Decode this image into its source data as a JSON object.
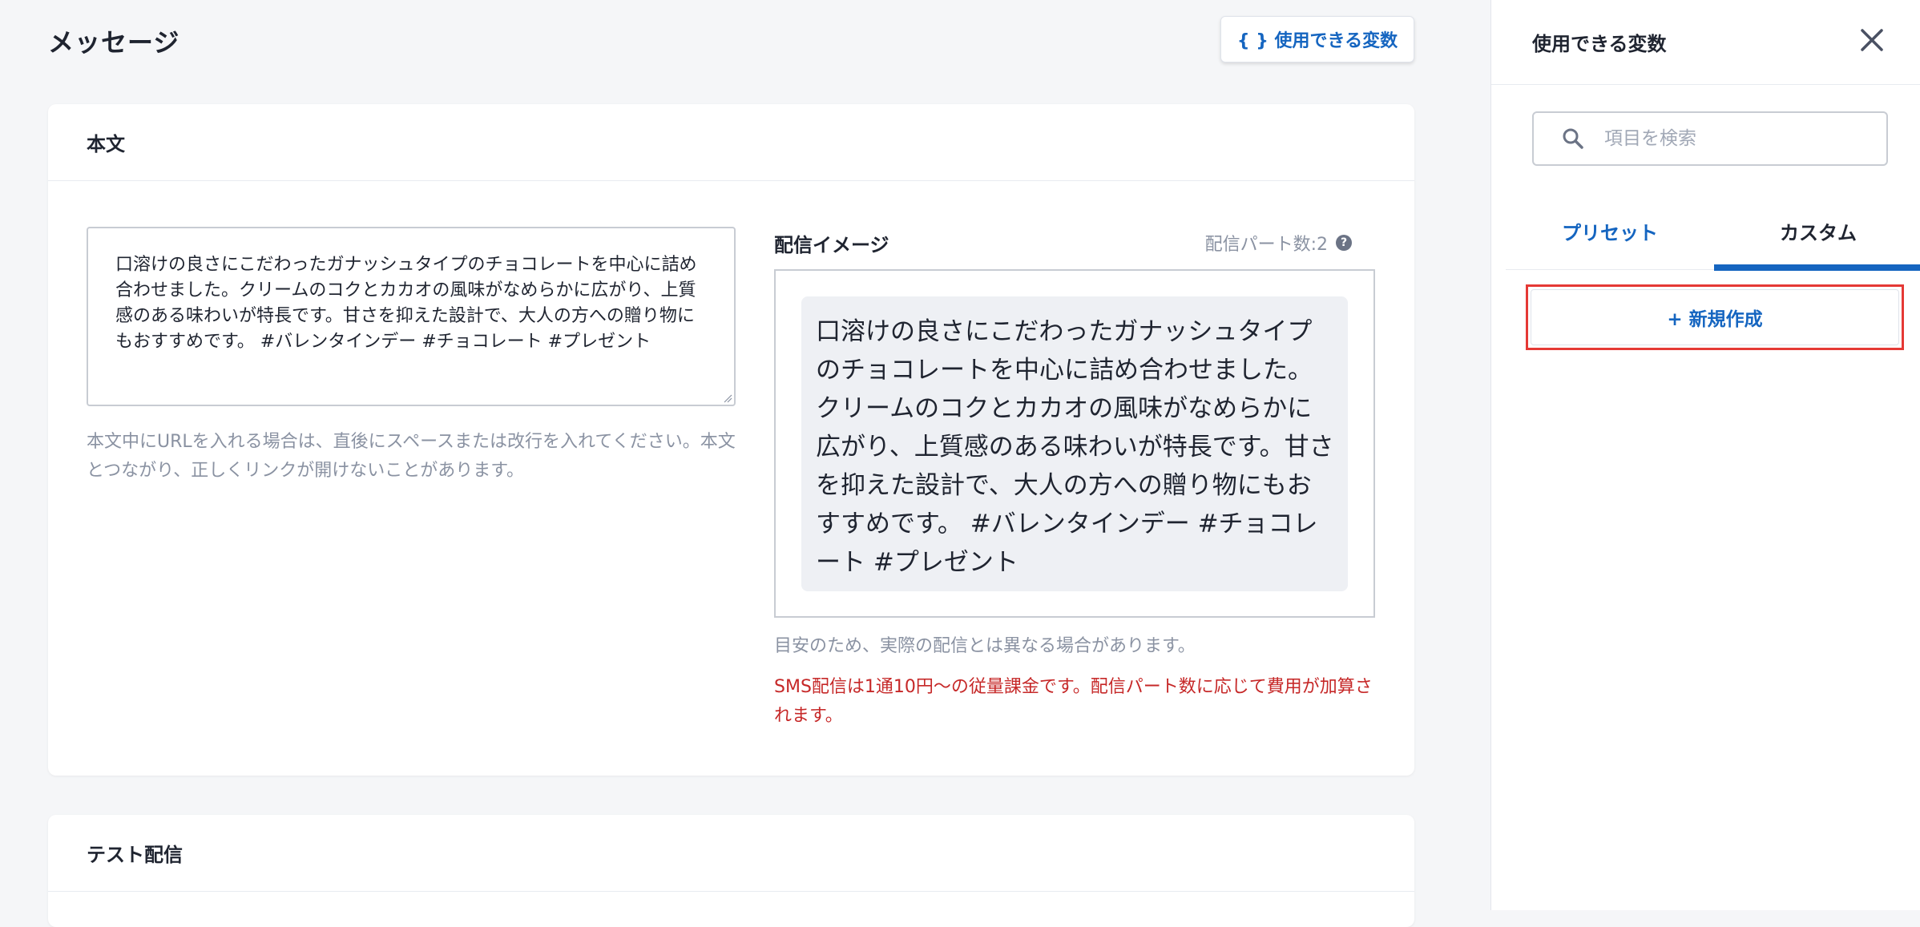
{
  "page": {
    "title": "メッセージ",
    "vars_button_label": "{ } 使用できる変数"
  },
  "body_card": {
    "title": "本文",
    "message_text": "口溶けの良さにこだわったガナッシュタイプのチョコレートを中心に詰め合わせました。クリームのコクとカカオの風味がなめらかに広がり、上質感のある味わいが特長です。甘さを抑えた設計で、大人の方への贈り物にもおすすめです。 #バレンタインデー #チョコレート #プレゼント",
    "url_hint": "本文中にURLを入れる場合は、直後にスペースまたは改行を入れてください。本文とつながり、正しくリンクが開けないことがあります。",
    "preview_label": "配信イメージ",
    "parts_count": "配信パート数:2",
    "help_glyph": "?",
    "preview_text": "口溶けの良さにこだわったガナッシュタイプのチョコレートを中心に詰め合わせました。クリームのコクとカカオの風味がなめらかに広がり、上質感のある味わいが特長です。甘さを抑えた設計で、大人の方への贈り物にもおすすめです。 #バレンタインデー #チョコレート #プレゼント",
    "disclaimer": "目安のため、実際の配信とは異なる場合があります。",
    "billing_warning": "SMS配信は1通10円〜の従量課金です。配信パート数に応じて費用が加算されます。"
  },
  "test_card": {
    "title": "テスト配信"
  },
  "side_panel": {
    "title": "使用できる変数",
    "search_placeholder": "項目を検索",
    "tabs": [
      {
        "label": "プリセット",
        "active": false
      },
      {
        "label": "カスタム",
        "active": true
      }
    ],
    "new_button_label": "+ 新規作成"
  },
  "icons": {
    "close": "close-icon",
    "search": "search-icon",
    "help": "help-icon"
  },
  "colors": {
    "accent": "#1565c0",
    "warning": "#c62828",
    "highlight_outline": "#e53935"
  }
}
